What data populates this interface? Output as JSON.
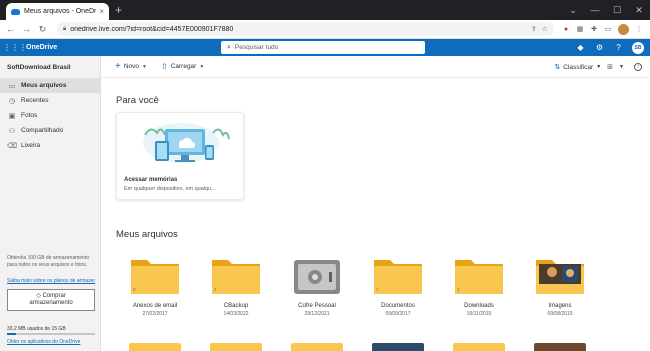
{
  "browser": {
    "tab_title": "Meus arquivos - OneDrive",
    "tab_close": "×",
    "new_tab": "+",
    "url": "onedrive.live.com/?id=root&cid=4457E000901F7880"
  },
  "suite": {
    "brand": "OneDrive",
    "search_placeholder": "Pesquisar tudo",
    "user_initials": "SB"
  },
  "nav": {
    "account": "SoftDownload Brasil",
    "items": [
      {
        "label": "Meus arquivos",
        "icon": "folder-icon",
        "active": true
      },
      {
        "label": "Recentes",
        "icon": "clock-icon",
        "active": false
      },
      {
        "label": "Fotos",
        "icon": "image-icon",
        "active": false
      },
      {
        "label": "Compartilhado",
        "icon": "people-icon",
        "active": false
      },
      {
        "label": "Lixeira",
        "icon": "trash-icon",
        "active": false
      }
    ],
    "storage_promo": "Obtenha 100 GB de armazenamento para todos os seus arquivos e fotos.",
    "storage_link": "Saiba mais sobre os planos de armazenamento",
    "buy_label_1": "Comprar",
    "buy_label_2": "armazenamento",
    "usage": "33,2 MB usados de 15 GB",
    "usage_fraction": 0.1,
    "get_apps": "Obter os aplicativos do OneDrive"
  },
  "commands": {
    "new": "Novo",
    "upload": "Carregar",
    "sort": "Classificar"
  },
  "main": {
    "for_you_heading": "Para você",
    "card_title": "Acessar memórias",
    "card_subtitle": "Em qualquer dispositivo, em qualqu...",
    "files_heading": "Meus arquivos",
    "folders": [
      {
        "name": "Anexos de email",
        "date": "27/02/2017",
        "count": "0",
        "type": "folder"
      },
      {
        "name": "CBackup",
        "date": "14/03/2022",
        "count": "1",
        "type": "folder"
      },
      {
        "name": "Cofre Pessoal",
        "date": "29/12/2021",
        "count": "",
        "type": "vault"
      },
      {
        "name": "Documentos",
        "date": "09/09/2017",
        "count": "1",
        "type": "folder"
      },
      {
        "name": "Downloads",
        "date": "16/11/2015",
        "count": "1",
        "type": "folder"
      },
      {
        "name": "Imagens",
        "date": "09/08/2019",
        "count": "",
        "type": "photo"
      }
    ]
  },
  "colors": {
    "accent": "#0f6cbd",
    "folder": "#f9c74f",
    "folder_dark": "#e8a317"
  }
}
